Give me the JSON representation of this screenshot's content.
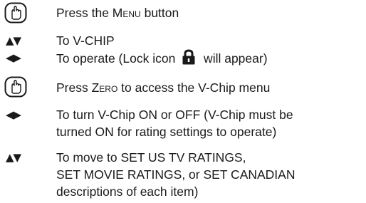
{
  "steps": [
    {
      "icon": "hand-press-icon",
      "pre": "Press the ",
      "key": "Menu",
      "post": " button"
    },
    {
      "icon": "up-down-arrows-icon",
      "text": "To V-CHIP"
    },
    {
      "icon": "left-right-arrows-icon",
      "pre": "To operate (Lock icon ",
      "post": " will appear)"
    },
    {
      "icon": "hand-press-icon",
      "pre": "Press ",
      "key": "Zero",
      "post": " to access the V-Chip menu"
    },
    {
      "icon": "left-right-arrows-icon",
      "lines": [
        "To turn V-Chip ON or OFF (V-Chip must be",
        "turned ON for rating settings to operate)"
      ]
    },
    {
      "icon": "up-down-arrows-icon",
      "lines": [
        "To move to SET US TV RATINGS,",
        "SET MOVIE RATINGS, or SET CANADIAN",
        "descriptions of each item)"
      ]
    }
  ],
  "glyphs": {
    "up_down": "▲▼",
    "left_right": "◀▶"
  }
}
